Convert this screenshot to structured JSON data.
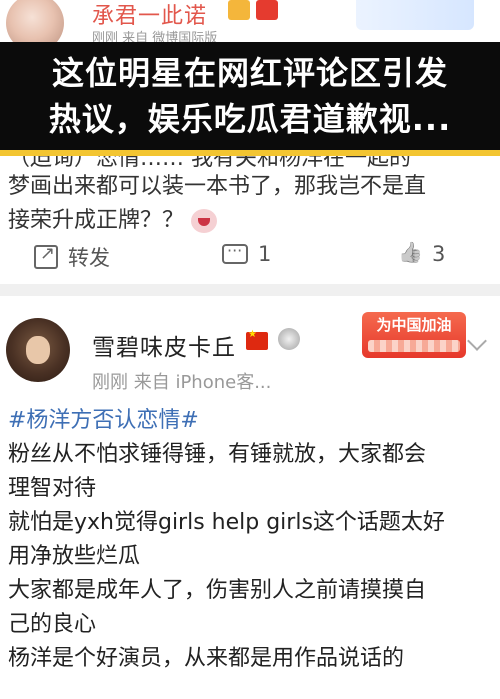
{
  "post1": {
    "author": "承君一此诺",
    "meta": "刚刚  来自 微博国际版",
    "text_cut": "（迫询）恋情……  我有关和杨洋在一起的",
    "text_lines": [
      "梦画出来都可以装一本书了，那我岂不是直",
      "接荣升成正牌？？"
    ],
    "actions": {
      "share": "转发",
      "comment": "1",
      "like": "3"
    }
  },
  "overlay": {
    "title_line1": "这位明星在网红评论区引发",
    "title_line2": "热议，娱乐吃瓜君道歉视..."
  },
  "post2": {
    "author": "雪碧味皮卡丘",
    "meta": "刚刚  来自 iPhone客...",
    "banner": "为中国加油",
    "hashtag": "#杨洋方否认恋情#",
    "lines": [
      "粉丝从不怕求锤得锤，有锤就放，大家都会",
      "理智对待",
      "就怕是yxh觉得girls help girls这个话题太好",
      "用净放些烂瓜",
      "大家都是成年人了，伤害别人之前请摸摸自",
      "己的良心",
      "杨洋是个好演员，从来都是用作品说话的"
    ]
  },
  "colors": {
    "accent_red": "#e2574c",
    "link_blue": "#3e6fb5",
    "title_bg": "#0b0b0b",
    "strip": "#f3c531"
  },
  "icons": [
    "share-icon",
    "comment-icon",
    "like-icon",
    "chevron-down-icon",
    "flag-icon",
    "medal-icon"
  ]
}
